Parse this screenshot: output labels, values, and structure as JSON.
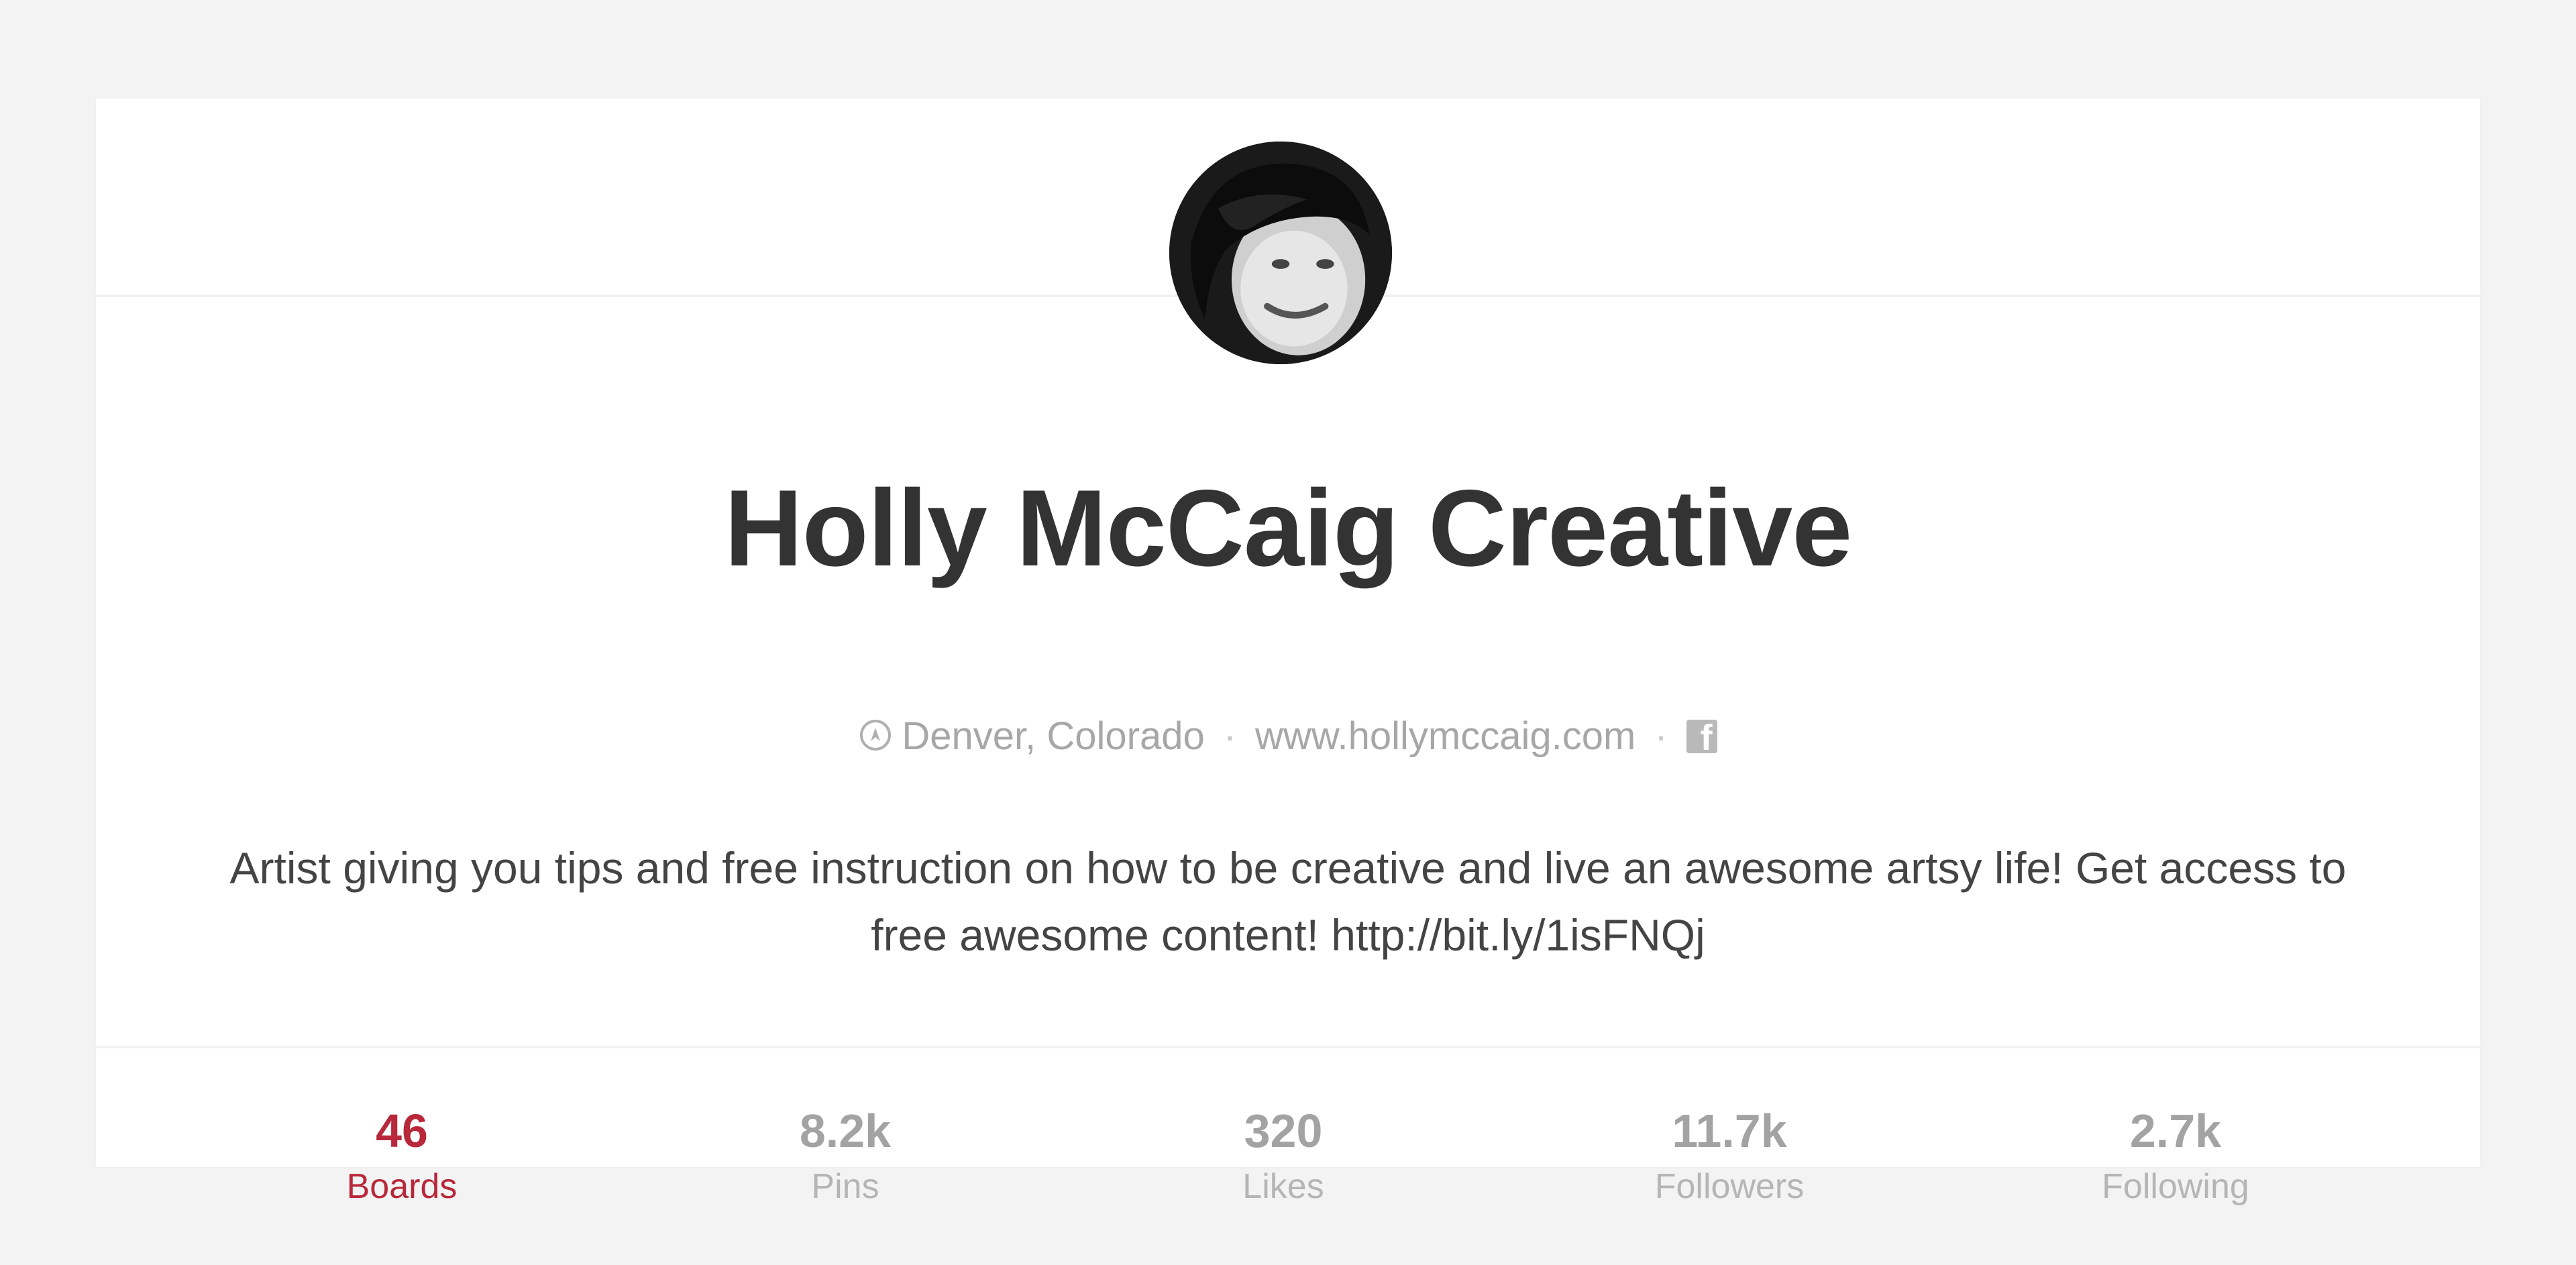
{
  "profile": {
    "name": "Holly McCaig Creative",
    "location": "Denver, Colorado",
    "website": "www.hollymccaig.com",
    "bio": "Artist giving you tips and free instruction on how to be creative and live an awesome artsy life! Get access to free awesome content! http://bit.ly/1isFNQj",
    "separator": "·",
    "social_icon": "facebook-icon"
  },
  "stats": [
    {
      "count": "46",
      "label": "Boards",
      "active": true
    },
    {
      "count": "8.2k",
      "label": "Pins",
      "active": false
    },
    {
      "count": "320",
      "label": "Likes",
      "active": false
    },
    {
      "count": "11.7k",
      "label": "Followers",
      "active": false
    },
    {
      "count": "2.7k",
      "label": "Following",
      "active": false
    }
  ],
  "colors": {
    "accent": "#b8283a",
    "name_text": "#333333",
    "muted_text": "#a7a7a7",
    "background": "#f3f3f3"
  }
}
